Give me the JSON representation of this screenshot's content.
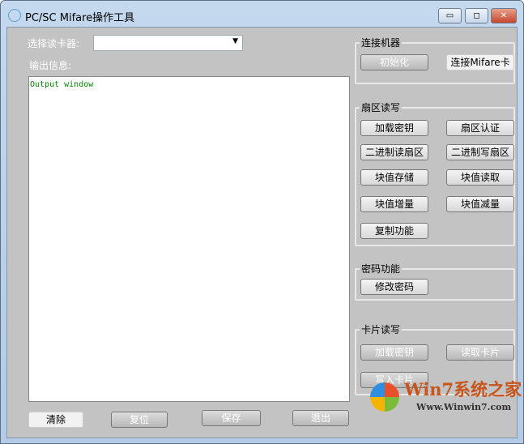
{
  "window": {
    "title": "PC/SC Mifare操作工具",
    "minimize": "▭",
    "maximize": "◻",
    "close": "✕"
  },
  "reader": {
    "label": "选择读卡器:",
    "value": "",
    "arrow": "▼"
  },
  "output": {
    "label": "输出信息:",
    "text": "Output window"
  },
  "groups": {
    "connect": {
      "title": "连接机器",
      "buttons": [
        "初始化",
        "连接Mifare卡"
      ]
    },
    "sector": {
      "title": "扇区读写",
      "buttons": [
        "加载密钥",
        "扇区认证",
        "二进制读扇区",
        "二进制写扇区",
        "块值存储",
        "块值读取",
        "块值增量",
        "块值减量",
        "复制功能"
      ]
    },
    "password": {
      "title": "密码功能",
      "buttons": [
        "修改密码"
      ]
    },
    "card": {
      "title": "卡片读写",
      "buttons": [
        "加载密钥",
        "读取卡片",
        "写入卡片"
      ]
    }
  },
  "bottom": {
    "buttons": [
      "清除",
      "复位",
      "保存",
      "退出"
    ]
  },
  "watermark": {
    "brand": "Win7系统之家",
    "url": "Www.Winwin7.com"
  }
}
